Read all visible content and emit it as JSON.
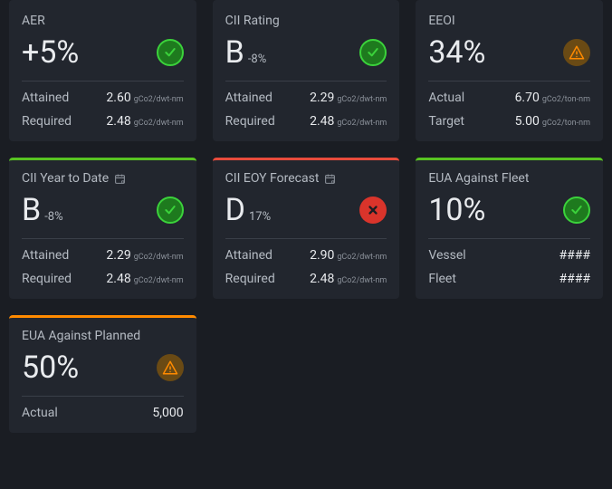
{
  "colors": {
    "accent_green": "#3bd23b",
    "accent_red": "#e84b3c",
    "accent_orange": "#ff8a00"
  },
  "cards": {
    "aer": {
      "title": "AER",
      "hero": "+5%",
      "status": "ok",
      "m1_label": "Attained",
      "m1_val": "2.60",
      "m1_unit": "gCo2/dwt-nm",
      "m2_label": "Required",
      "m2_val": "2.48",
      "m2_unit": "gCo2/dwt-nm"
    },
    "cii_rating": {
      "title": "CII Rating",
      "hero": "B",
      "hero_sub": "-8%",
      "status": "ok",
      "m1_label": "Attained",
      "m1_val": "2.29",
      "m1_unit": "gCo2/dwt-nm",
      "m2_label": "Required",
      "m2_val": "2.48",
      "m2_unit": "gCo2/dwt-nm"
    },
    "eeoi": {
      "title": "EEOI",
      "hero": "34%",
      "status": "warn",
      "m1_label": "Actual",
      "m1_val": "6.70",
      "m1_unit": "gCo2/ton-nm",
      "m2_label": "Target",
      "m2_val": "5.00",
      "m2_unit": "gCo2/ton-nm"
    },
    "cii_ytd": {
      "title": "CII Year to Date",
      "hero": "B",
      "hero_sub": "-8%",
      "status": "ok",
      "m1_label": "Attained",
      "m1_val": "2.29",
      "m1_unit": "gCo2/dwt-nm",
      "m2_label": "Required",
      "m2_val": "2.48",
      "m2_unit": "gCo2/dwt-nm"
    },
    "cii_eoy": {
      "title": "CII EOY Forecast",
      "hero": "D",
      "hero_sub": "17%",
      "status": "err",
      "m1_label": "Attained",
      "m1_val": "2.90",
      "m1_unit": "gCo2/dwt-nm",
      "m2_label": "Required",
      "m2_val": "2.48",
      "m2_unit": "gCo2/dwt-nm"
    },
    "eua_fleet": {
      "title": "EUA Against Fleet",
      "hero": "10%",
      "status": "ok",
      "m1_label": "Vessel",
      "m1_val": "####",
      "m2_label": "Fleet",
      "m2_val": "####"
    },
    "eua_planned": {
      "title": "EUA Against Planned",
      "hero": "50%",
      "status": "warn",
      "m1_label": "Actual",
      "m1_val": "5,000"
    }
  }
}
